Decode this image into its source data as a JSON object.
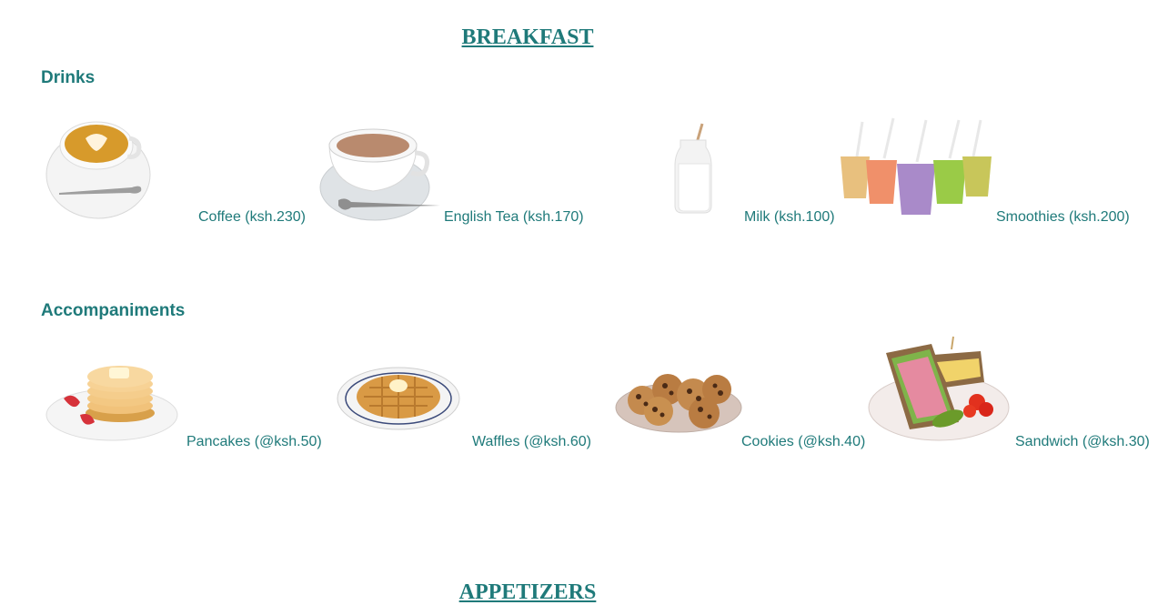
{
  "sections": [
    {
      "title": "BREAKFAST"
    },
    {
      "title": "APPETIZERS"
    }
  ],
  "breakfast": {
    "drinks": {
      "heading": "Drinks",
      "items": [
        {
          "label": "Coffee (ksh.230)",
          "icon": "coffee-cup"
        },
        {
          "label": "English Tea (ksh.170)",
          "icon": "tea-cup"
        },
        {
          "label": "Milk (ksh.100)",
          "icon": "milk-bottle"
        },
        {
          "label": "Smoothies (ksh.200)",
          "icon": "smoothie-cups"
        }
      ]
    },
    "accompaniments": {
      "heading": "Accompaniments",
      "items": [
        {
          "label": "Pancakes (@ksh.50)",
          "icon": "pancakes-plate"
        },
        {
          "label": "Waffles (@ksh.60)",
          "icon": "waffle-plate"
        },
        {
          "label": "Cookies (@ksh.40)",
          "icon": "cookies-plate"
        },
        {
          "label": "Sandwich (@ksh.30)",
          "icon": "sandwich-plate"
        }
      ]
    }
  },
  "colors": {
    "accent": "#1f7a7a"
  }
}
